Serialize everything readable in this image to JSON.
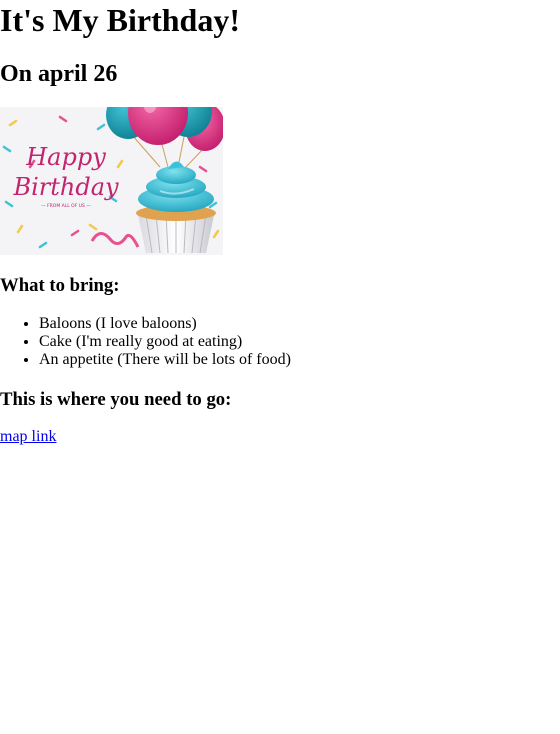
{
  "page": {
    "title": "It's My Birthday!",
    "date_line": "On april 26"
  },
  "banner": {
    "text_happy": "Happy",
    "text_birthday": "Birthday",
    "text_from": "— FROM ALL OF US —"
  },
  "bring": {
    "heading": "What to bring:",
    "items": [
      "Baloons (I love baloons)",
      "Cake (I'm really good at eating)",
      "An appetite (There will be lots of food)"
    ]
  },
  "directions": {
    "heading": "This is where you need to go:",
    "link_label": "map link"
  }
}
